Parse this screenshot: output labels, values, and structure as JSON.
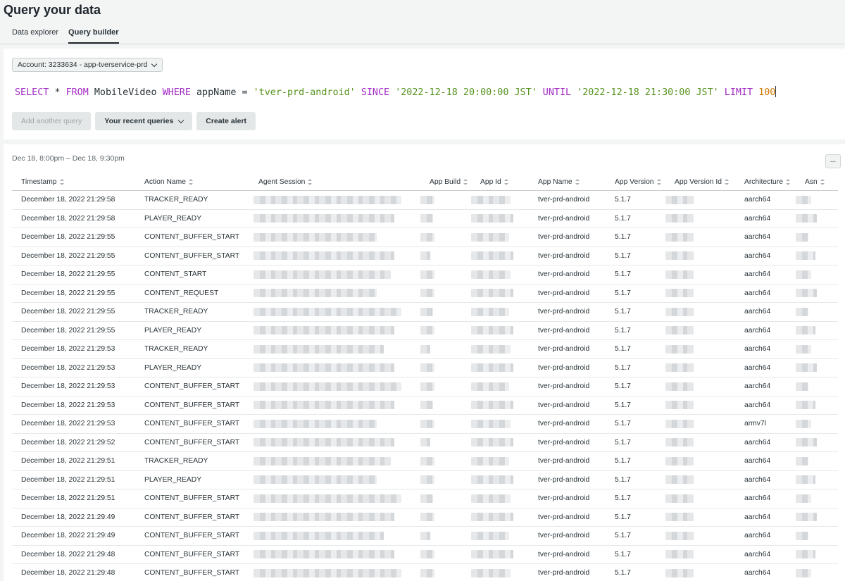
{
  "page": {
    "title": "Query your data"
  },
  "tabs": [
    {
      "label": "Data explorer",
      "active": false
    },
    {
      "label": "Query builder",
      "active": true
    }
  ],
  "account": {
    "label": "Account: 3233634 - app-tverservice-prd"
  },
  "query": {
    "tokens": [
      {
        "t": "SELECT",
        "c": "kw"
      },
      {
        "t": " "
      },
      {
        "t": "*",
        "c": "plain"
      },
      {
        "t": " "
      },
      {
        "t": "FROM",
        "c": "kw"
      },
      {
        "t": " MobileVideo ",
        "c": "plain"
      },
      {
        "t": "WHERE",
        "c": "kw"
      },
      {
        "t": " appName = ",
        "c": "plain"
      },
      {
        "t": "'tver-prd-android'",
        "c": "str"
      },
      {
        "t": " "
      },
      {
        "t": "SINCE",
        "c": "kw"
      },
      {
        "t": " "
      },
      {
        "t": "'2022-12-18 20:00:00 JST'",
        "c": "str"
      },
      {
        "t": " "
      },
      {
        "t": "UNTIL",
        "c": "kw"
      },
      {
        "t": " "
      },
      {
        "t": "'2022-12-18 21:30:00 JST'",
        "c": "str"
      },
      {
        "t": " "
      },
      {
        "t": "LIMIT",
        "c": "kw"
      },
      {
        "t": " "
      },
      {
        "t": "100",
        "c": "num"
      }
    ]
  },
  "buttons": {
    "add_query": "Add another query",
    "recent": "Your recent queries",
    "alert": "Create alert"
  },
  "results": {
    "range": "Dec 18, 8:00pm – Dec 18, 9:30pm",
    "more": "...",
    "columns": [
      "Timestamp",
      "Action Name",
      "Agent Session",
      "App Build",
      "App Id",
      "App Name",
      "App Version",
      "App Version Id",
      "Architecture",
      "Asn"
    ],
    "rows": [
      [
        "December 18, 2022 21:29:58",
        "TRACKER_READY",
        "tver-prd-android",
        "5.1.7",
        "aarch64"
      ],
      [
        "December 18, 2022 21:29:58",
        "PLAYER_READY",
        "tver-prd-android",
        "5.1.7",
        "aarch64"
      ],
      [
        "December 18, 2022 21:29:55",
        "CONTENT_BUFFER_START",
        "tver-prd-android",
        "5.1.7",
        "aarch64"
      ],
      [
        "December 18, 2022 21:29:55",
        "CONTENT_BUFFER_START",
        "tver-prd-android",
        "5.1.7",
        "aarch64"
      ],
      [
        "December 18, 2022 21:29:55",
        "CONTENT_START",
        "tver-prd-android",
        "5.1.7",
        "aarch64"
      ],
      [
        "December 18, 2022 21:29:55",
        "CONTENT_REQUEST",
        "tver-prd-android",
        "5.1.7",
        "aarch64"
      ],
      [
        "December 18, 2022 21:29:55",
        "TRACKER_READY",
        "tver-prd-android",
        "5.1.7",
        "aarch64"
      ],
      [
        "December 18, 2022 21:29:55",
        "PLAYER_READY",
        "tver-prd-android",
        "5.1.7",
        "aarch64"
      ],
      [
        "December 18, 2022 21:29:53",
        "TRACKER_READY",
        "tver-prd-android",
        "5.1.7",
        "aarch64"
      ],
      [
        "December 18, 2022 21:29:53",
        "PLAYER_READY",
        "tver-prd-android",
        "5.1.7",
        "aarch64"
      ],
      [
        "December 18, 2022 21:29:53",
        "CONTENT_BUFFER_START",
        "tver-prd-android",
        "5.1.7",
        "aarch64"
      ],
      [
        "December 18, 2022 21:29:53",
        "CONTENT_BUFFER_START",
        "tver-prd-android",
        "5.1.7",
        "aarch64"
      ],
      [
        "December 18, 2022 21:29:53",
        "CONTENT_BUFFER_START",
        "tver-prd-android",
        "5.1.7",
        "armv7l"
      ],
      [
        "December 18, 2022 21:29:52",
        "CONTENT_BUFFER_START",
        "tver-prd-android",
        "5.1.7",
        "aarch64"
      ],
      [
        "December 18, 2022 21:29:51",
        "TRACKER_READY",
        "tver-prd-android",
        "5.1.7",
        "aarch64"
      ],
      [
        "December 18, 2022 21:29:51",
        "PLAYER_READY",
        "tver-prd-android",
        "5.1.7",
        "aarch64"
      ],
      [
        "December 18, 2022 21:29:51",
        "CONTENT_BUFFER_START",
        "tver-prd-android",
        "5.1.7",
        "aarch64"
      ],
      [
        "December 18, 2022 21:29:49",
        "CONTENT_BUFFER_START",
        "tver-prd-android",
        "5.1.7",
        "aarch64"
      ],
      [
        "December 18, 2022 21:29:49",
        "CONTENT_BUFFER_START",
        "tver-prd-android",
        "5.1.7",
        "aarch64"
      ],
      [
        "December 18, 2022 21:29:48",
        "CONTENT_BUFFER_START",
        "tver-prd-android",
        "5.1.7",
        "aarch64"
      ],
      [
        "December 18, 2022 21:29:48",
        "CONTENT_BUFFER_START",
        "tver-prd-android",
        "5.1.7",
        "aarch64"
      ]
    ]
  }
}
